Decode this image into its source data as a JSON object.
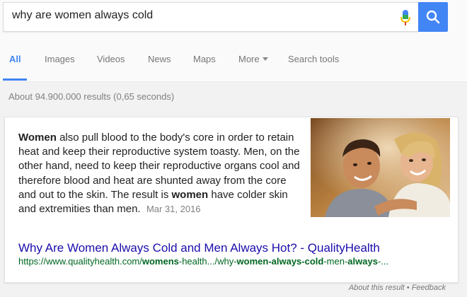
{
  "search": {
    "query": "why are women always cold"
  },
  "tabs": [
    {
      "label": "All",
      "active": true
    },
    {
      "label": "Images"
    },
    {
      "label": "Videos"
    },
    {
      "label": "News"
    },
    {
      "label": "Maps"
    },
    {
      "label": "More"
    },
    {
      "label": "Search tools"
    }
  ],
  "result_stats": "About 94.900.000 results (0,65 seconds)",
  "featured_snippet": {
    "text_parts": [
      {
        "text": "Women",
        "bold": true
      },
      {
        "text": " also pull blood to the body's core in order to retain heat and keep their reproductive system toasty. Men, on the other hand, need to keep their reproductive organs cool and therefore blood and heat are shunted away from the core and out to the skin. The result is "
      },
      {
        "text": "women",
        "bold": true
      },
      {
        "text": " have colder skin and extremities than men."
      }
    ],
    "date": "Mar 31, 2016",
    "title": "Why Are Women Always Cold and Men Always Hot? - QualityHealth",
    "url_parts": [
      {
        "text": "https://www.qualityhealth.com/"
      },
      {
        "text": "womens",
        "bold": true
      },
      {
        "text": "-health.../why-"
      },
      {
        "text": "women-always-cold",
        "bold": true
      },
      {
        "text": "-men-"
      },
      {
        "text": "always",
        "bold": true
      },
      {
        "text": "-..."
      }
    ]
  },
  "footer": {
    "about": "About this result",
    "separator": "•",
    "feedback": "Feedback"
  },
  "colors": {
    "accent": "#4285f4",
    "link": "#1a0dab",
    "url": "#006621"
  },
  "icons": {
    "mic": "microphone-icon",
    "search": "search-icon"
  }
}
